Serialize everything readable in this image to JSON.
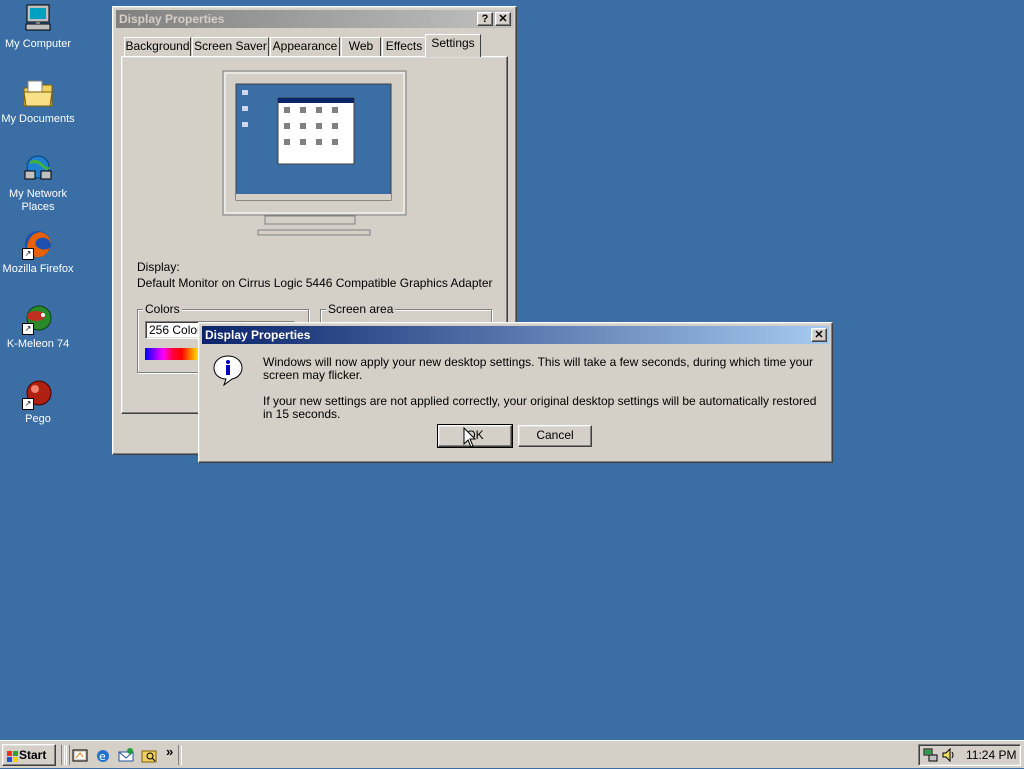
{
  "desktop": {
    "icons": [
      {
        "label": "My Computer"
      },
      {
        "label": "My Documents"
      },
      {
        "label": "My Network Places"
      },
      {
        "label": "Mozilla Firefox"
      },
      {
        "label": "K-Meleon 74"
      },
      {
        "label": "Pego"
      }
    ],
    "background_color": "#3a6ea5"
  },
  "display_properties": {
    "title": "Display Properties",
    "help_btn": "?",
    "close_btn": "✕",
    "tabs": [
      {
        "label": "Background"
      },
      {
        "label": "Screen Saver"
      },
      {
        "label": "Appearance"
      },
      {
        "label": "Web"
      },
      {
        "label": "Effects"
      },
      {
        "label": "Settings",
        "selected": true
      }
    ],
    "display_label": "Display:",
    "display_value": "Default Monitor on Cirrus Logic 5446 Compatible Graphics Adapter",
    "colors_group": "Colors",
    "colors_value": "256 Colors",
    "screen_area_group": "Screen area"
  },
  "dialog": {
    "title": "Display Properties",
    "close_btn": "✕",
    "message1": "Windows will now apply your new desktop settings. This will take a few seconds, during which time your screen may flicker.",
    "message2": "If your new settings are not applied correctly, your original desktop settings will be automatically restored in 15 seconds.",
    "ok_label": "OK",
    "cancel_label": "Cancel",
    "icon": "information-icon"
  },
  "taskbar": {
    "start_label": "Start",
    "chevron": "»",
    "clock": "11:24 PM"
  }
}
